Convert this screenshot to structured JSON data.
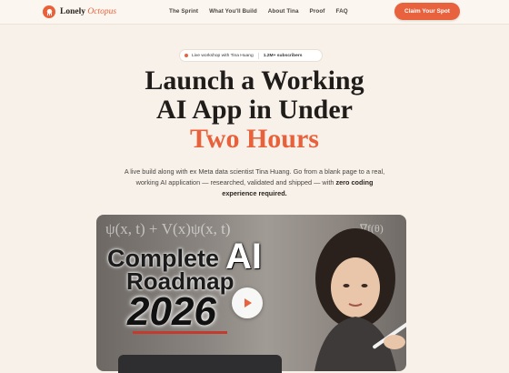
{
  "header": {
    "logo_main": "Lonely",
    "logo_accent": "Octopus",
    "nav": [
      "The Sprint",
      "What You'll Build",
      "About Tina",
      "Proof",
      "FAQ"
    ],
    "cta_label": "Claim Your Spot"
  },
  "pill": {
    "left_text": "Live workshop with Tina Huang",
    "right_text": "1.2M+ subscribers"
  },
  "hero": {
    "line1": "Launch a Working",
    "line2": "AI App in Under",
    "line3": "Two Hours",
    "subtitle": "A live build along with ex Meta data scientist Tina Huang. Go from a blank page to a real, working AI application — researched, validated and shipped — with",
    "subtitle_bold": "zero coding experience required."
  },
  "video": {
    "formula_left": "ψ(x, t) + V(x)ψ(x, t)",
    "formula_right": "∇f(θ)",
    "word_complete": "Complete",
    "word_ai": "AI",
    "word_roadmap": "Roadmap",
    "word_year": "2026"
  },
  "colors": {
    "accent": "#e8613a",
    "background": "#f7f1ea"
  },
  "icons": {
    "logo": "octopus-icon",
    "play": "play-icon"
  }
}
